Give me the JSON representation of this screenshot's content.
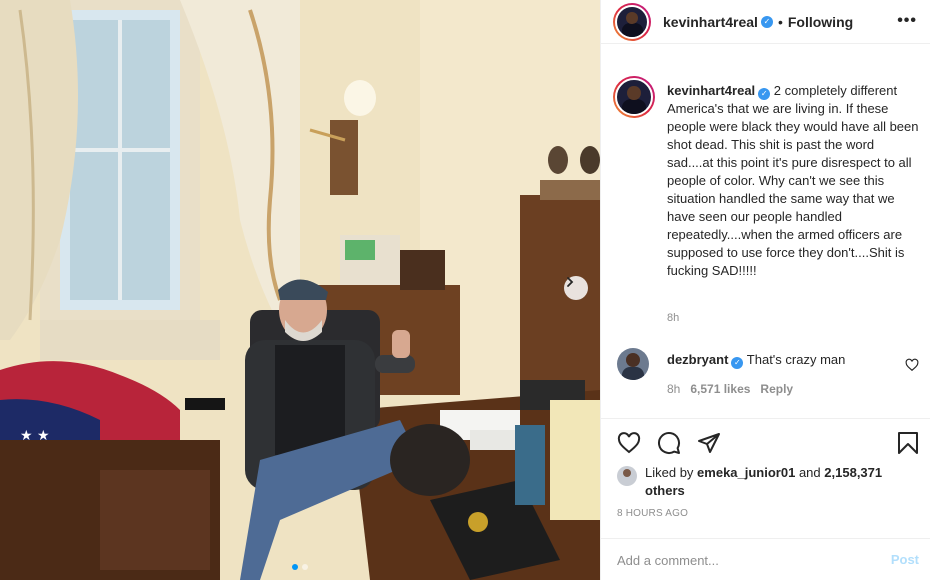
{
  "post": {
    "author": "kevinhart4real",
    "follow_separator": "•",
    "follow_status": "Following",
    "more_icon": "•••",
    "caption": "2 completely different America's that we are living in. If these people were black they would have all been shot dead. This shit is past the word sad....at this point it's pure disrespect to all people of color. Why can't we see this situation handled the same way that we have seen our people handled repeatedly....when the armed officers are supposed to use force they don't....Shit is fucking SAD!!!!!",
    "caption_time": "8h",
    "verified_icon": "check-badge-icon"
  },
  "comment": {
    "user": "dezbryant",
    "text": "That's crazy man",
    "time": "8h",
    "likes": "6,571 likes",
    "reply": "Reply"
  },
  "likes": {
    "prefix": "Liked by",
    "user": "emeka_junior01",
    "and": "and",
    "count": "2,158,371 others"
  },
  "timestamp": "8 HOURS AGO",
  "add_comment": {
    "placeholder": "Add a comment...",
    "post_label": "Post"
  },
  "carousel": {
    "current_index": 1,
    "total": 2
  },
  "colors": {
    "verified": "#3897f0",
    "link_disabled": "#b2dffc",
    "active_dot": "#0095f6",
    "muted": "#8e8e8e"
  }
}
